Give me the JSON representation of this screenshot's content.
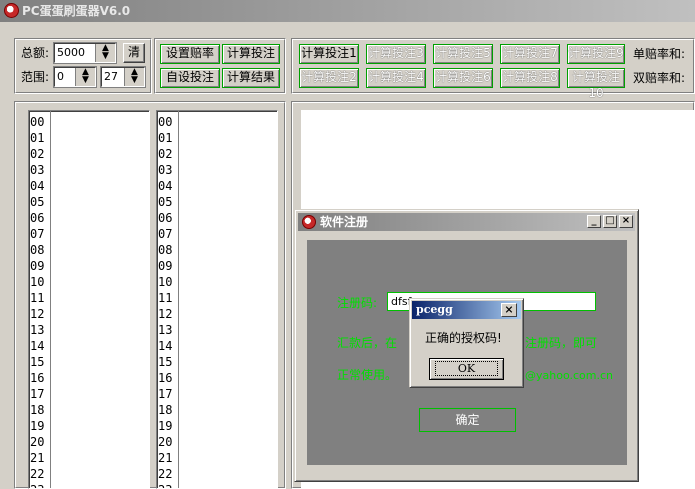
{
  "window": {
    "title": "PC蛋蛋刷蛋器V6.0"
  },
  "controls": {
    "total_label": "总额:",
    "total_value": "5000",
    "clear_label": "清",
    "range_label": "范围:",
    "range_from": "0",
    "range_to": "27",
    "set_odds": "设置赔率",
    "calc_bet": "计算投注",
    "custom_bet": "自设投注",
    "calc_result": "计算结果"
  },
  "calc_buttons": [
    "计算投注1",
    "计算投注3",
    "计算投注5",
    "计算投注7",
    "计算投注9",
    "计算投注2",
    "计算投注4",
    "计算投注6",
    "计算投注8",
    "计算投注10"
  ],
  "odds": {
    "single_label": "单赔率和:",
    "double_label": "双赔率和:"
  },
  "list_numbers": [
    "00",
    "01",
    "02",
    "03",
    "04",
    "05",
    "06",
    "07",
    "08",
    "09",
    "10",
    "11",
    "12",
    "13",
    "14",
    "15",
    "16",
    "17",
    "18",
    "19",
    "20",
    "21",
    "22",
    "23"
  ],
  "reg_dialog": {
    "title": "软件注册",
    "code_label": "注册码:",
    "code_value": "dfsf",
    "line1_left": "汇款后，在",
    "line1_right": "注册码，即可",
    "line2_left": "正常使用。",
    "line2_right": "@yahoo.com.cn",
    "confirm": "确定"
  },
  "message_box": {
    "title": "pcegg",
    "text": "正确的授权码!",
    "ok": "OK"
  }
}
